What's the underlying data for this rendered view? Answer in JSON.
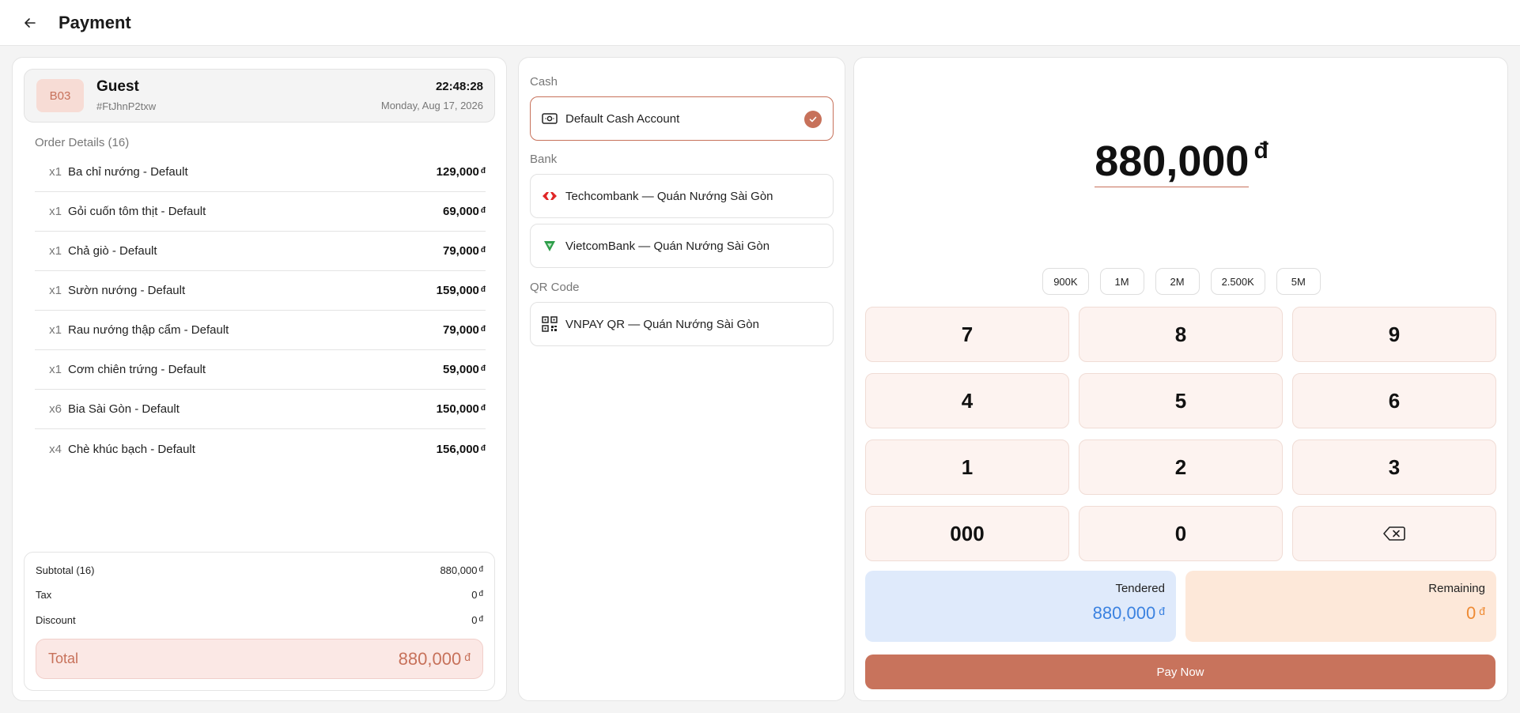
{
  "header": {
    "title": "Payment",
    "back_icon": "arrow-left-icon"
  },
  "customer": {
    "table": "B03",
    "name": "Guest",
    "order_id": "#FtJhnP2txw",
    "time": "22:48:28",
    "date": "Monday, Aug 17, 2026"
  },
  "order": {
    "title": "Order Details (16)",
    "currency": "đ",
    "items": [
      {
        "qty": "x1",
        "name": "Ba chỉ nướng - Default",
        "price": "129,000"
      },
      {
        "qty": "x1",
        "name": "Gỏi cuốn tôm thịt - Default",
        "price": "69,000"
      },
      {
        "qty": "x1",
        "name": "Chả giò - Default",
        "price": "79,000"
      },
      {
        "qty": "x1",
        "name": "Sườn nướng - Default",
        "price": "159,000"
      },
      {
        "qty": "x1",
        "name": "Rau nướng thập cẩm - Default",
        "price": "79,000"
      },
      {
        "qty": "x1",
        "name": "Cơm chiên trứng - Default",
        "price": "59,000"
      },
      {
        "qty": "x6",
        "name": "Bia Sài Gòn - Default",
        "price": "150,000"
      },
      {
        "qty": "x4",
        "name": "Chè khúc bạch - Default",
        "price": "156,000"
      }
    ]
  },
  "summary": {
    "subtotal_label": "Subtotal (16)",
    "subtotal_value": "880,000",
    "tax_label": "Tax",
    "tax_value": "0",
    "discount_label": "Discount",
    "discount_value": "0",
    "total_label": "Total",
    "total_value": "880,000",
    "currency": "đ"
  },
  "methods": {
    "cash_label": "Cash",
    "bank_label": "Bank",
    "qr_label": "QR Code",
    "cash": {
      "label": "Default Cash Account",
      "icon": "cash-icon",
      "selected": true
    },
    "techcombank": {
      "label": "Techcombank — Quán Nướng Sài Gòn",
      "icon": "techcombank-logo-icon"
    },
    "vietcombank": {
      "label": "VietcomBank — Quán Nướng Sài Gòn",
      "icon": "vietcombank-logo-icon"
    },
    "vnpay": {
      "label": "VNPAY QR — Quán Nướng Sài Gòn",
      "icon": "qr-code-icon"
    }
  },
  "amount": {
    "value": "880,000",
    "currency": "đ"
  },
  "quick_amounts": [
    "900K",
    "1M",
    "2M",
    "2.500K",
    "5M"
  ],
  "keypad": {
    "k7": "7",
    "k8": "8",
    "k9": "9",
    "k4": "4",
    "k5": "5",
    "k6": "6",
    "k1": "1",
    "k2": "2",
    "k3": "3",
    "k000": "000",
    "k0": "0",
    "backspace_icon": "backspace-icon"
  },
  "tendered": {
    "label": "Tendered",
    "value": "880,000",
    "currency": "đ"
  },
  "remaining": {
    "label": "Remaining",
    "value": "0",
    "currency": "đ"
  },
  "pay_button": "Pay Now",
  "colors": {
    "accent": "#c8735c",
    "tendered_blue": "#3b82e0",
    "remaining_orange": "#ee8a33"
  }
}
